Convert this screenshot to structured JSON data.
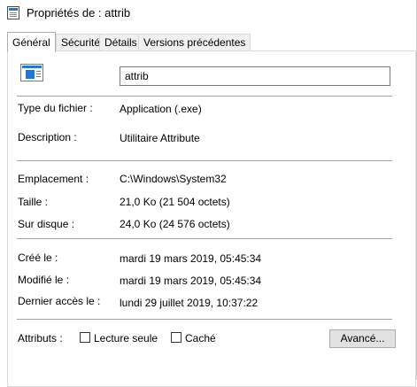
{
  "window": {
    "title": "Propriétés de : attrib",
    "title_icon": "properties-window-icon"
  },
  "tabs": [
    {
      "label": "Général",
      "active": true
    },
    {
      "label": "Sécurité",
      "active": false
    },
    {
      "label": "Détails",
      "active": false
    },
    {
      "label": "Versions précédentes",
      "active": false
    }
  ],
  "general": {
    "file_icon": "executable-file-icon",
    "name_value": "attrib",
    "type": {
      "label": "Type du fichier :",
      "value": "Application (.exe)"
    },
    "description": {
      "label": "Description :",
      "value": "Utilitaire Attribute"
    },
    "location": {
      "label": "Emplacement :",
      "value": "C:\\Windows\\System32"
    },
    "size": {
      "label": "Taille :",
      "value": "21,0 Ko (21 504 octets)"
    },
    "size_on_disk": {
      "label": "Sur disque :",
      "value": "24,0 Ko (24 576 octets)"
    },
    "created": {
      "label": "Créé le :",
      "value": "mardi 19 mars 2019, 05:45:34"
    },
    "modified": {
      "label": "Modifié le :",
      "value": "mardi 19 mars 2019, 05:45:34"
    },
    "accessed": {
      "label": "Dernier accès le :",
      "value": "lundi 29 juillet 2019, 10:37:22"
    },
    "attributes": {
      "label": "Attributs :",
      "readonly": {
        "label": "Lecture seule",
        "checked": false
      },
      "hidden": {
        "label": "Caché",
        "checked": false
      },
      "advanced_button": "Avancé..."
    }
  }
}
